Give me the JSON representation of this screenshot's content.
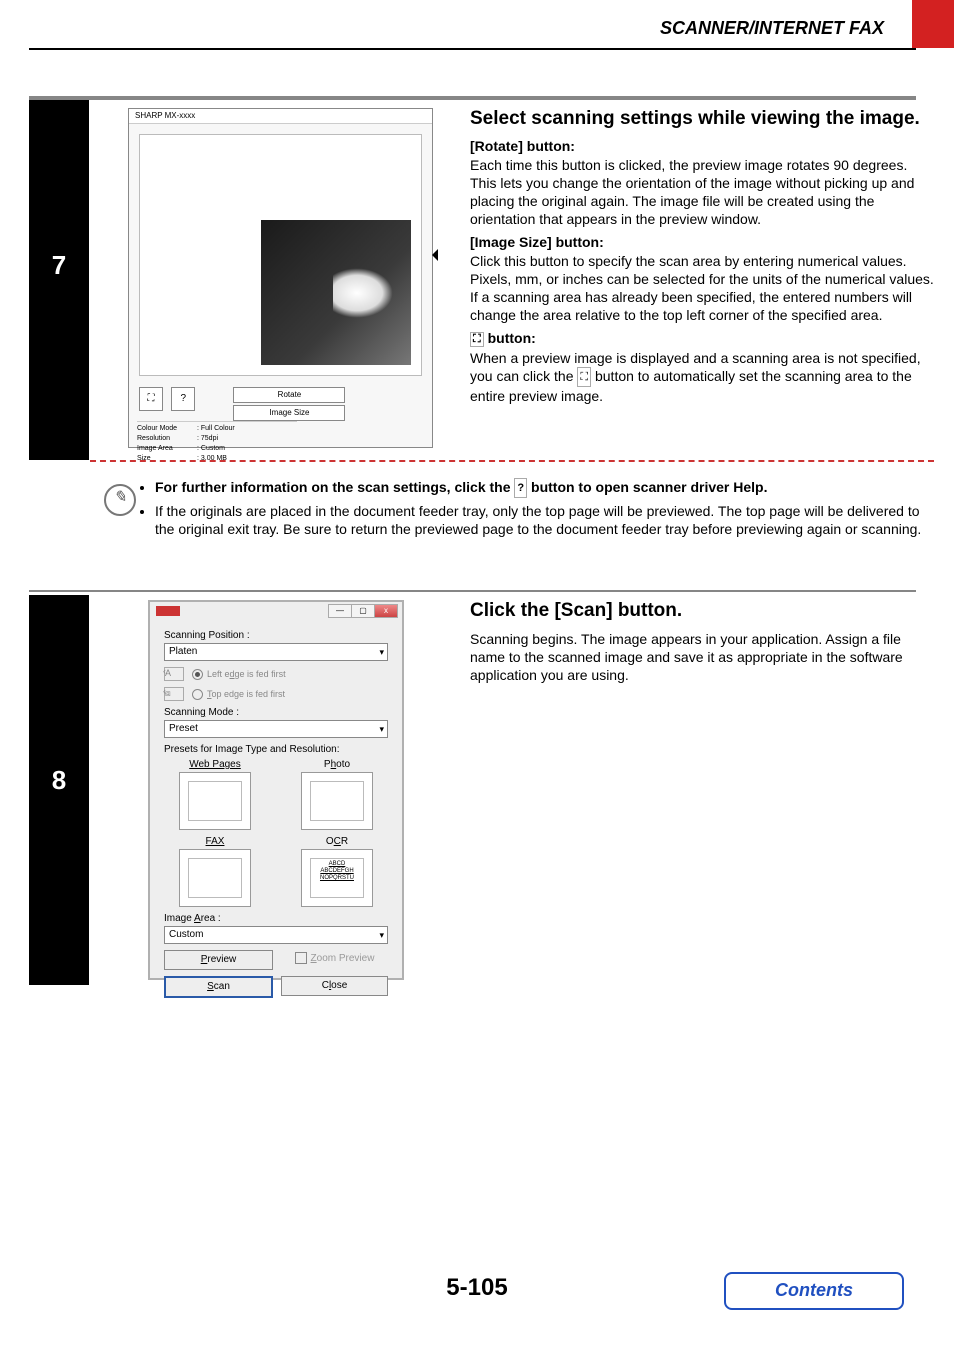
{
  "header": {
    "section_title": "SCANNER/INTERNET FAX"
  },
  "step7": {
    "number": "7",
    "screenshot": {
      "window_title": "SHARP MX-xxxx",
      "rotate_btn": "Rotate",
      "image_size_btn": "Image Size",
      "info": {
        "colour_mode_label": "Colour Mode",
        "colour_mode_value": "Full Colour",
        "resolution_label": "Resolution",
        "resolution_value": "75dpi",
        "image_area_label": "Image Area",
        "image_area_value": "Custom",
        "size_label": "Size",
        "size_value": "3.00 MB"
      }
    },
    "heading": "Select scanning settings while viewing the image.",
    "rotate_label": "[Rotate] button:",
    "rotate_body": "Each time this button is clicked, the preview image rotates 90 degrees. This lets you change the orientation of the image without picking up and placing the original again. The image file will be created using the orientation that appears in the preview window.",
    "imgsize_label": "[Image Size] button:",
    "imgsize_body": "Click this button to specify the scan area by entering numerical values. Pixels, mm, or inches can be selected for the units of the numerical values. If a scanning area has already been specified, the entered numbers will change the area relative to the top left corner of the specified area.",
    "auto_label_suffix": " button:",
    "auto_body_1": "When a preview image is displayed and a scanning area is not specified, you can click the ",
    "auto_body_2": " button to automatically set the scanning area to the entire preview image."
  },
  "note": {
    "bullet1_pre": "For further information on the scan settings, click the ",
    "bullet1_post": " button to open scanner driver Help.",
    "bullet2": "If the originals are placed in the document feeder tray, only the top page will be previewed. The top page will be delivered to the original exit tray. Be sure to return the previewed page to the document feeder tray before previewing again or scanning."
  },
  "step8": {
    "number": "8",
    "heading": "Click the [Scan] button.",
    "body": "Scanning begins. The image appears in your application. Assign a file name to the scanned image and save it as appropriate in the software application you are using.",
    "dialog": {
      "scanning_position_label": "Scanning Position :",
      "scanning_position_value": "Platen",
      "radio_left": "Left edge is fed first",
      "radio_top": "Top edge is fed first",
      "scanning_mode_label": "Scanning Mode :",
      "scanning_mode_value": "Preset",
      "presets_label": "Presets for Image Type and Resolution:",
      "preset_web": "Web Pages",
      "preset_photo": "Photo",
      "preset_fax": "FAX",
      "preset_ocr": "OCR",
      "image_area_label": "Image Area :",
      "image_area_value": "Custom",
      "preview_btn": "Preview",
      "zoom_preview": "Zoom Preview",
      "scan_btn": "Scan",
      "close_btn": "Close"
    }
  },
  "footer": {
    "page_number": "5-105",
    "contents": "Contents"
  },
  "icons": {
    "auto_area": "⛶",
    "help": "?"
  }
}
